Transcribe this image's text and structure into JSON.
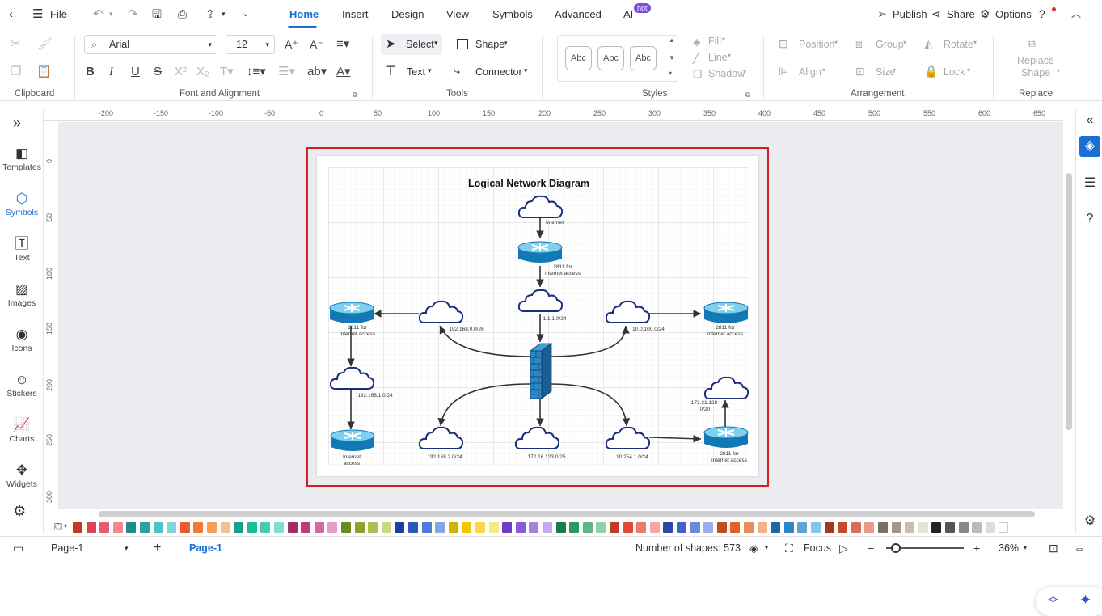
{
  "menubar": {
    "file_label": "File",
    "tabs": [
      "Home",
      "Insert",
      "Design",
      "View",
      "Symbols",
      "Advanced",
      "AI"
    ],
    "active_tab": "Home",
    "ai_badge": "hot",
    "publish_label": "Publish",
    "share_label": "Share",
    "options_label": "Options"
  },
  "ribbon": {
    "font_name": "Arial",
    "font_size": "12",
    "select_label": "Select",
    "shape_label": "Shape",
    "text_label": "Text",
    "connector_label": "Connector",
    "style_boxes": [
      "Abc",
      "Abc",
      "Abc"
    ],
    "fill_label": "Fill",
    "line_label": "Line",
    "shadow_label": "Shadow",
    "position_label": "Position",
    "group_label": "Group",
    "rotate_label": "Rotate",
    "align_label": "Align",
    "size_label": "Size",
    "lock_label": "Lock",
    "replace_shape_line1": "Replace",
    "replace_shape_line2": "Shape",
    "groups": {
      "clipboard": "Clipboard",
      "font": "Font and Alignment",
      "tools": "Tools",
      "styles": "Styles",
      "arrangement": "Arrangement",
      "replace": "Replace"
    }
  },
  "sidebar": {
    "items": [
      {
        "label": "Templates",
        "icon": "templates-icon"
      },
      {
        "label": "Symbols",
        "icon": "symbols-icon"
      },
      {
        "label": "Text",
        "icon": "text-icon"
      },
      {
        "label": "Images",
        "icon": "images-icon"
      },
      {
        "label": "Icons",
        "icon": "icons-icon"
      },
      {
        "label": "Stickers",
        "icon": "stickers-icon"
      },
      {
        "label": "Charts",
        "icon": "charts-icon"
      },
      {
        "label": "Widgets",
        "icon": "widgets-icon"
      }
    ],
    "active": "Symbols"
  },
  "rulers": {
    "horizontal": [
      "-200",
      "-150",
      "-100",
      "-50",
      "0",
      "50",
      "100",
      "150",
      "200",
      "250",
      "300",
      "350",
      "400",
      "450",
      "500",
      "550",
      "600",
      "650"
    ],
    "vertical": [
      "0",
      "50",
      "100",
      "150",
      "200",
      "250",
      "300"
    ]
  },
  "diagram": {
    "title": "Logical Network Diagram",
    "labels": {
      "internet": "Internet",
      "router_top_1": "2811 for",
      "router_top_2": "internet access",
      "net_center": "1.1.1.0/24",
      "net_left": "192.168.0.0/26",
      "net_right": "10.0.100.0/24",
      "router_left_1": "2811 for",
      "router_left_2": "internet access",
      "router_right_1": "2811 for",
      "router_right_2": "internet access",
      "net_left_mid": "192.168.1.0/24",
      "router_bl_1": "Internet",
      "router_bl_2": "access",
      "net_b1": "192.168.2.0/24",
      "net_b2": "172.16.123.0/25",
      "net_b3": "10.254.1.0/24",
      "net_br_top_1": "173.31.128",
      "net_br_top_2": ".0/20",
      "router_br_1": "2811 for",
      "router_br_2": "internet access"
    }
  },
  "palette": [
    "#c0392b",
    "#d64550",
    "#e35d6a",
    "#f08a94",
    "#1f8a8a",
    "#27a3a3",
    "#4fc0c8",
    "#7fd6de",
    "#e85d2a",
    "#f07a3a",
    "#f5a05a",
    "#f7c08a",
    "#16a085",
    "#1abc9c",
    "#48c9b0",
    "#85dbc9",
    "#9b2d6a",
    "#c0397f",
    "#d867a0",
    "#e89cc1",
    "#6a8a1f",
    "#8aa32b",
    "#a9c24f",
    "#c8da86",
    "#1f3fa0",
    "#2b55c4",
    "#5478d8",
    "#8aa2e6",
    "#d4b000",
    "#f0c800",
    "#f5d84a",
    "#f9e88a",
    "#6a3fc4",
    "#8a5ad8",
    "#a97ee6",
    "#c8a8f0",
    "#1f7a4a",
    "#2b9a5f",
    "#5ab880",
    "#8fd2aa",
    "#c0392b",
    "#e0483a",
    "#ee7a6e",
    "#f5a8a0",
    "#2a4aa0",
    "#3b64c4",
    "#6a8ad8",
    "#9cb0e6",
    "#c44a1f",
    "#e0622b",
    "#ee8a5a",
    "#f5b28a",
    "#1f6aa0",
    "#2b86c4",
    "#5aa6d8",
    "#8ac4e6",
    "#a03a1f",
    "#c44a2b",
    "#d86e5a",
    "#e69c8a",
    "#7a7060",
    "#a09880",
    "#c8c0a8",
    "#e8e2d0",
    "#222222",
    "#555555",
    "#888888",
    "#bbbbbb",
    "#dddddd",
    "#ffffff"
  ],
  "statusbar": {
    "page_select": "Page-1",
    "page_tab": "Page-1",
    "shapes_count": "Number of shapes: 573",
    "focus_label": "Focus",
    "zoom": "36%"
  }
}
